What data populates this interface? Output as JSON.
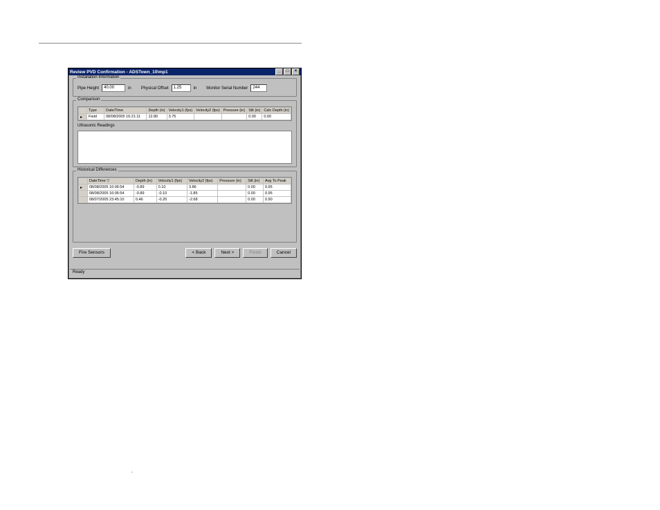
{
  "window": {
    "title": "Review PVD Confirmation - ADSTown_10\\mp1"
  },
  "install": {
    "legend": "Installation Information",
    "pipe_height": {
      "label": "Pipe Height",
      "value": "40.00",
      "unit": "in"
    },
    "physical_offset": {
      "label": "Physical Offset",
      "value": "1.25",
      "unit": "in"
    },
    "monitor_serial": {
      "label": "Monitor Serial Number",
      "value": "244"
    }
  },
  "comparison": {
    "legend": "Comparison",
    "headers": [
      "Type",
      "Date/Time",
      "Depth (in)",
      "Velocity1 (fps)",
      "Velocity2 (fps)",
      "Pressure (in)",
      "Silt (in)",
      "Calc Depth (in)"
    ],
    "rows": [
      [
        "Field",
        "08/08/2005 16:21:11",
        "12.80",
        "3.75",
        "",
        "",
        "0.00",
        "0.00"
      ]
    ],
    "ultrasonic_label": "Ultrasonic Readings"
  },
  "historical": {
    "legend": "Historical Differences",
    "headers": [
      "DateTime        ▽",
      "Depth (in)",
      "Velocity1 (fps)",
      "Velocity2 (fps)",
      "Pressure (in)",
      "Silt (in)",
      "Avg To Peak"
    ],
    "rows": [
      [
        "08/08/2005 16:06:54",
        "-0.89",
        "0.10",
        "3.86",
        "",
        "0.00",
        "0.95"
      ],
      [
        "08/08/2005 16:06:54",
        "-0.89",
        "-0.10",
        "-1.85",
        "",
        "0.00",
        "0.95"
      ],
      [
        "08/07/2005 23:45:10",
        "0.46",
        "-0.20",
        "-2.68",
        "",
        "0.00",
        "0.90"
      ]
    ]
  },
  "buttons": {
    "fire_sensors": "Fire Sensors",
    "back": "< Back",
    "next": "Next >",
    "finish": "Finish",
    "cancel": "Cancel"
  },
  "status": "Ready"
}
